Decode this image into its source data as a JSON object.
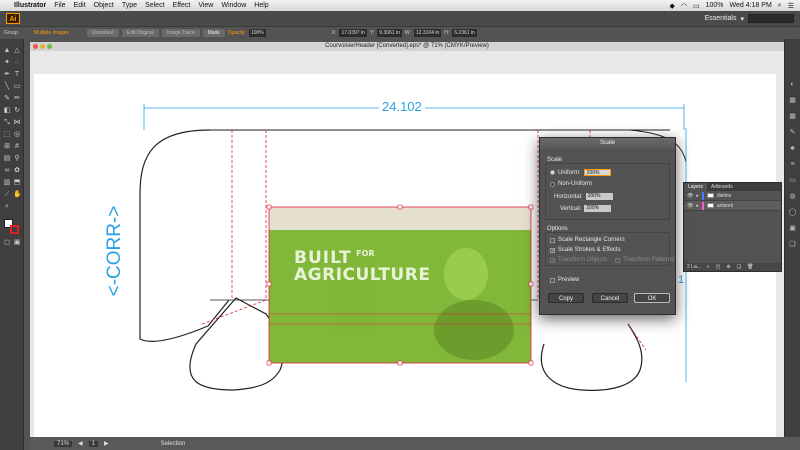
{
  "menubar": {
    "app": "Illustrator",
    "items": [
      "File",
      "Edit",
      "Object",
      "Type",
      "Select",
      "Effect",
      "View",
      "Window",
      "Help"
    ],
    "battery": "100%",
    "clock": "Wed 4:18 PM"
  },
  "appbar": {
    "logo": "Ai",
    "workspace": "Essentials"
  },
  "controlbar": {
    "selection_type": "Group",
    "multiple_images": "Multiple Images",
    "buttons": [
      "Unembed",
      "Edit Original",
      "Image Trace",
      "Mask"
    ],
    "opacity_label": "Opacity:",
    "opacity_value": "100%",
    "x_label": "X:",
    "x_value": "17.0397 in",
    "y_label": "Y:",
    "y_value": "9.3061 in",
    "w_label": "W:",
    "w_value": "12.3104 in",
    "h_label": "H:",
    "h_value": "6.2361 in"
  },
  "document": {
    "title": "CourvoisierHeader [Converted].eps* @ 71% (CMYK/Preview)",
    "dimension_label": "24.102",
    "side_label": "<-CORR->",
    "right_label": "1",
    "headline_line1": "BUILT",
    "headline_for": "FOR",
    "headline_line2": "AGRICULTURE"
  },
  "status": {
    "zoom": "71%",
    "artboard": "1",
    "mode": "Selection"
  },
  "dialog": {
    "title": "Scale",
    "scale_section": "Scale",
    "uniform_label": "Uniform:",
    "uniform_value": "200%",
    "non_uniform_label": "Non-Uniform",
    "horizontal_label": "Horizontal:",
    "horizontal_value": "200%",
    "vertical_label": "Vertical:",
    "vertical_value": "200%",
    "options_section": "Options",
    "opt_corners": "Scale Rectangle Corners",
    "opt_strokes": "Scale Strokes & Effects",
    "opt_objects": "Transform Objects",
    "opt_patterns": "Transform Patterns",
    "preview": "Preview",
    "copy": "Copy",
    "cancel": "Cancel",
    "ok": "OK"
  },
  "layers": {
    "tabs": [
      "Layers",
      "Artboards"
    ],
    "rows": [
      {
        "name": "dieline",
        "color": "#4a7bff"
      },
      {
        "name": "artwork",
        "color": "#ff5ad2"
      }
    ],
    "footer": "2 La..."
  },
  "colors": {
    "accent": "#ff9a00",
    "dim_line": "#29a3e6",
    "green": "#8cc63f",
    "red_guide": "#e0203a"
  }
}
